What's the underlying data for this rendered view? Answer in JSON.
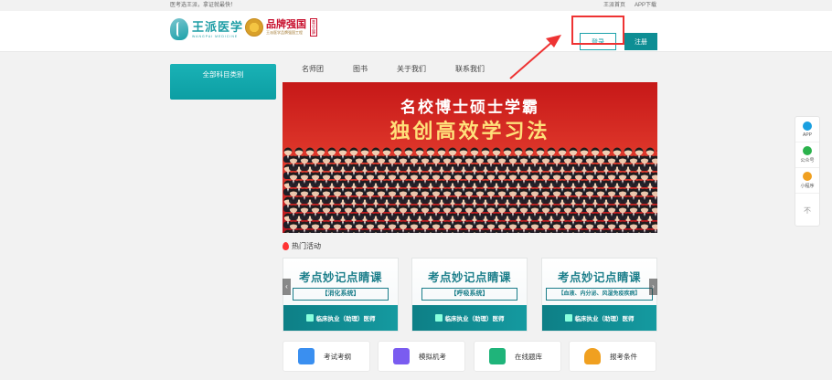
{
  "topbar": {
    "slogan": "医考选王派，拿证就最快！",
    "links": [
      "王派首页",
      "APP下载"
    ]
  },
  "header": {
    "logo_cn": "王派医学",
    "logo_en": "WANGPAI MEDICINE",
    "brand_title": "品牌强国",
    "brand_sub": "王派医学品牌强国工程",
    "brand_tag": "重点品牌",
    "login_label": "登录",
    "register_label": "注册"
  },
  "category_button": "全部科目类别",
  "nav": [
    "名师团",
    "图书",
    "关于我们",
    "联系我们"
  ],
  "banner": {
    "line1": "名校博士硕士学霸",
    "line2": "独创高效学习法"
  },
  "hot": {
    "label": "热门活动"
  },
  "cards": [
    {
      "title": "考点妙记点睛课",
      "subtitle": "【消化系统】",
      "footer": "临床执业（助理）医师"
    },
    {
      "title": "考点妙记点睛课",
      "subtitle": "【呼吸系统】",
      "footer": "临床执业（助理）医师"
    },
    {
      "title": "考点妙记点睛课",
      "subtitle": "【血液、内分泌、风湿免疫疾病】",
      "footer": "临床执业（助理）医师"
    }
  ],
  "carousel": {
    "prev": "‹",
    "next": "›"
  },
  "quick": [
    {
      "label": "考试考纲",
      "icon": "document-icon",
      "color": "#3a8ff0"
    },
    {
      "label": "模拟机考",
      "icon": "chart-icon",
      "color": "#7a5cf0"
    },
    {
      "label": "在线题库",
      "icon": "book-icon",
      "color": "#1fb47a"
    },
    {
      "label": "报考条件",
      "icon": "trophy-icon",
      "color": "#f0a020"
    }
  ],
  "sidebar": [
    {
      "label": "APP",
      "color": "#1a9fe0"
    },
    {
      "label": "公众号",
      "color": "#2bb24c"
    },
    {
      "label": "小程序",
      "color": "#f0a020"
    }
  ],
  "sidebar_close": "不",
  "colors": {
    "accent": "#0e8e94",
    "highlight": "#ee3333"
  }
}
